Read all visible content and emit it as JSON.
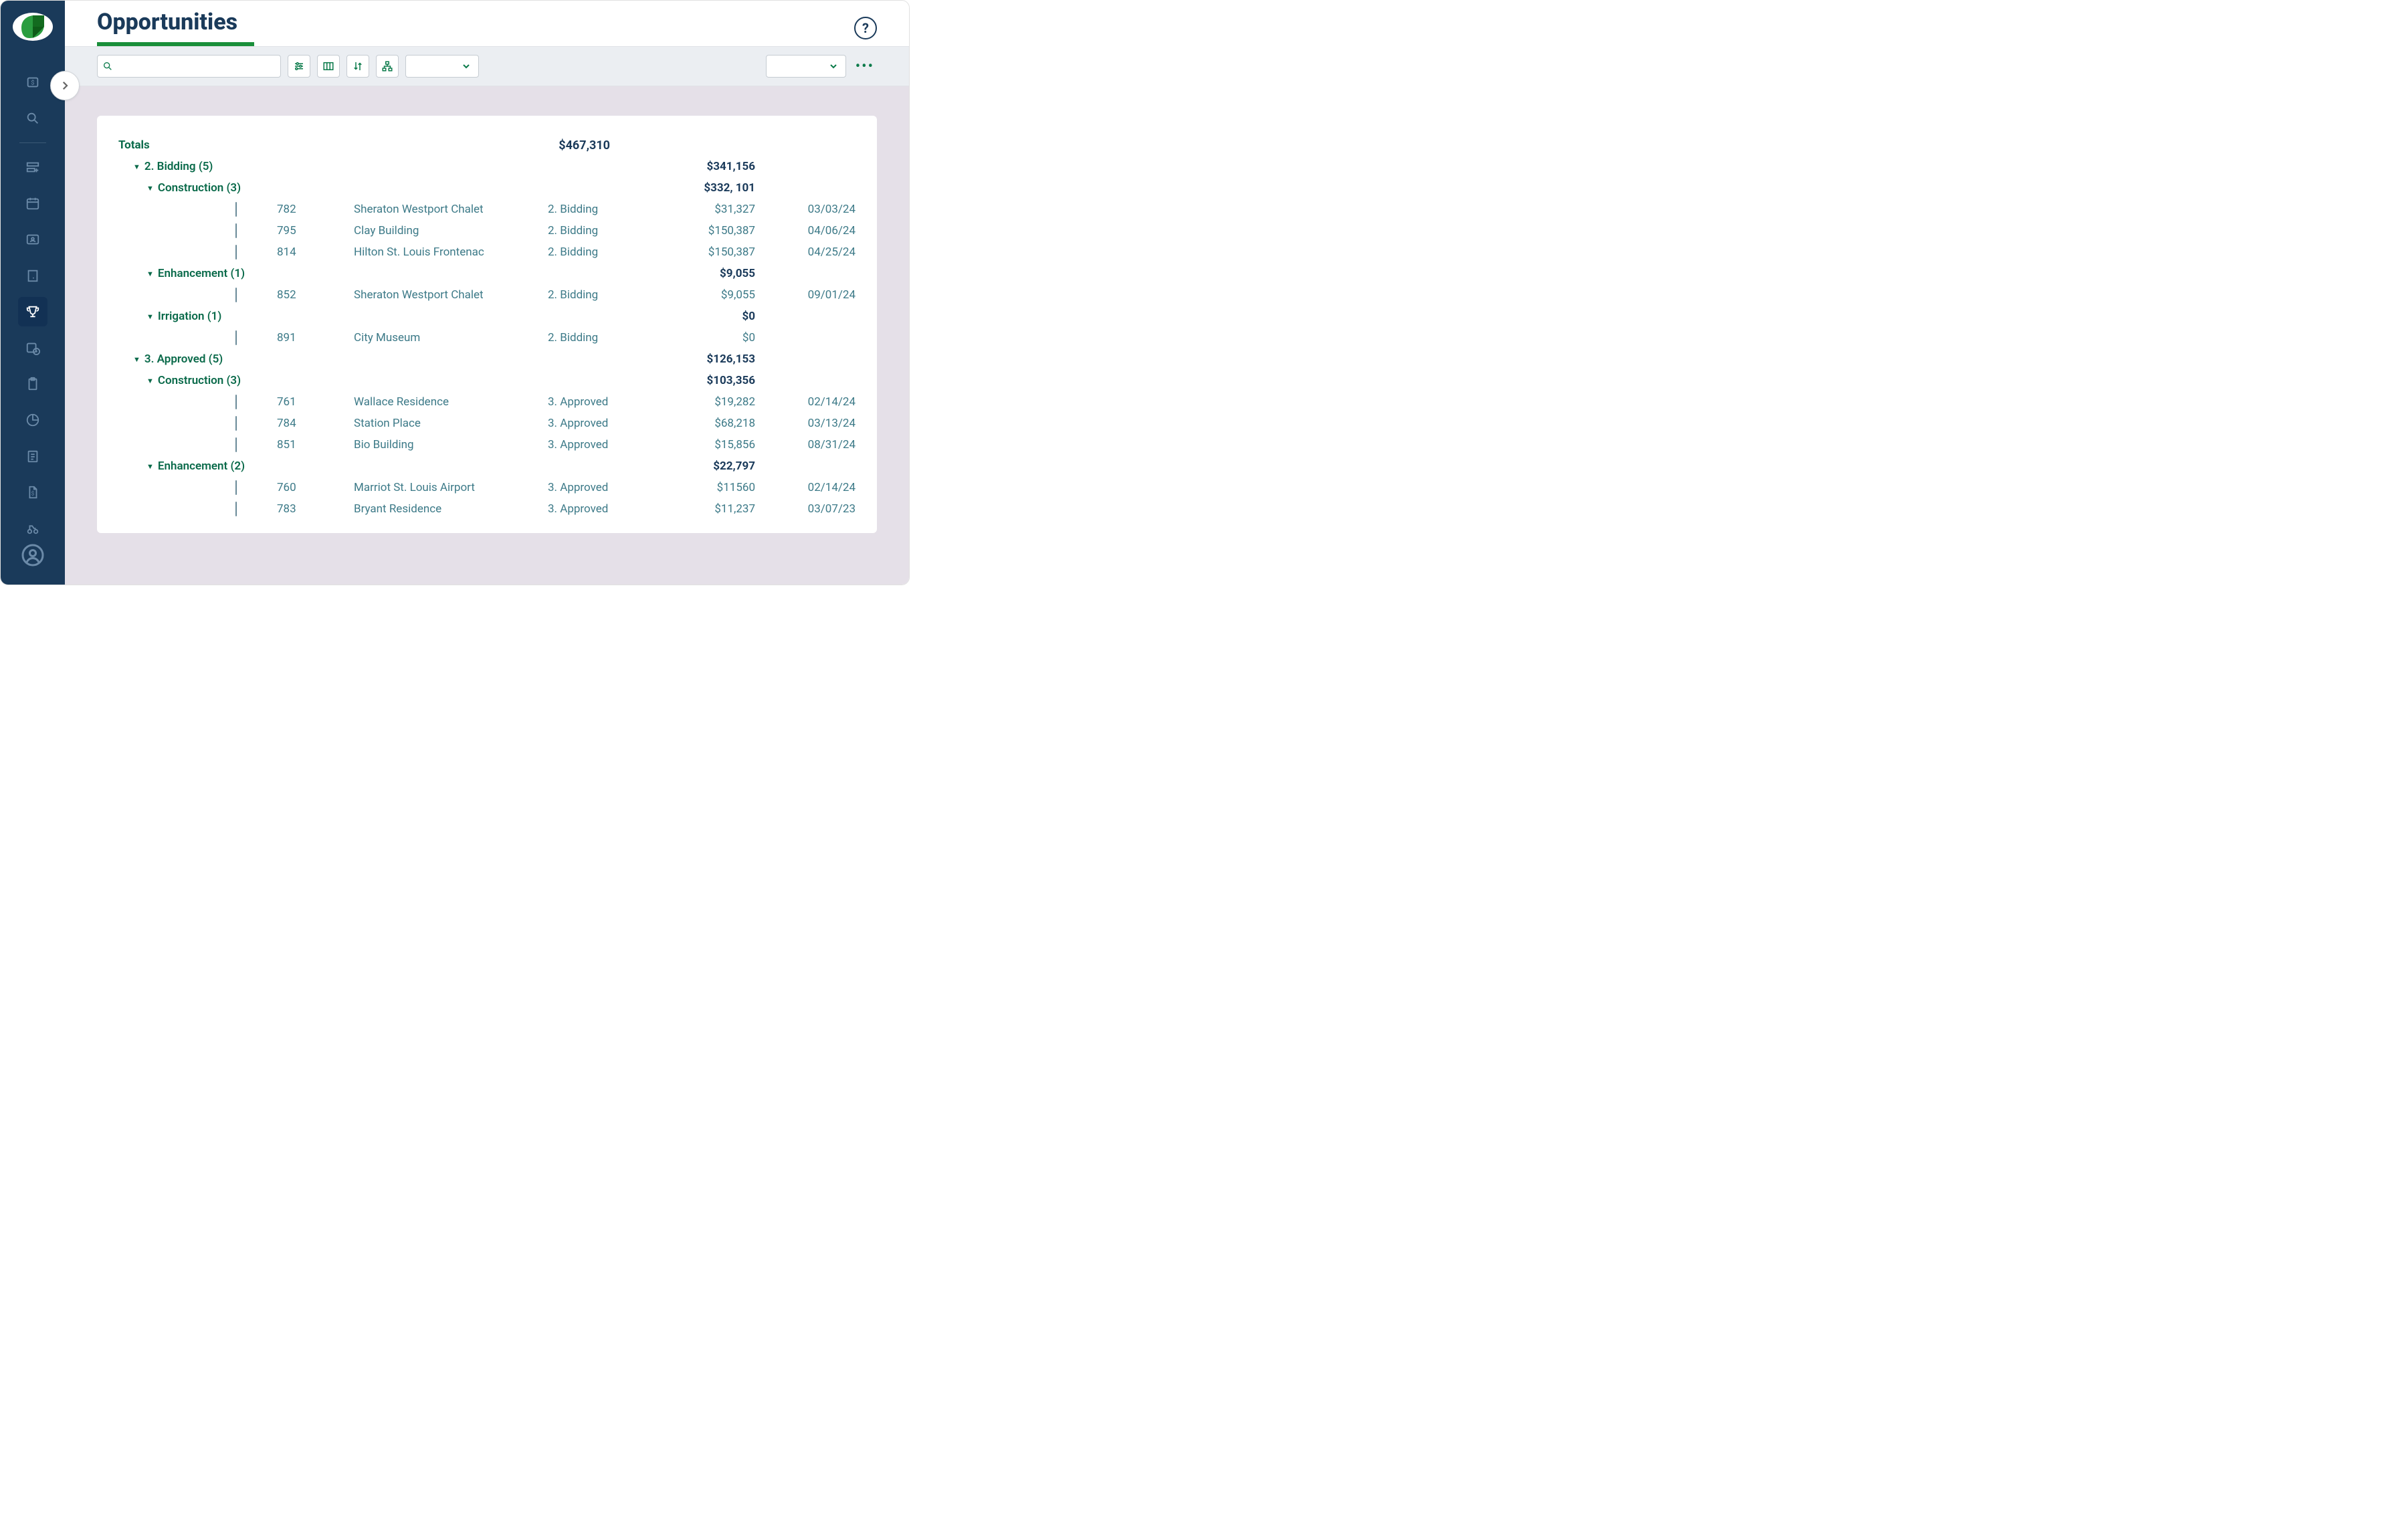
{
  "page": {
    "title": "Opportunities"
  },
  "help": {
    "label": "?"
  },
  "search": {
    "placeholder": ""
  },
  "totals": {
    "label": "Totals",
    "amount": "$467,310"
  },
  "groups": [
    {
      "label": "2. Bidding (5)",
      "amount": "$341,156",
      "subgroups": [
        {
          "label": "Construction (3)",
          "amount": "$332, 101",
          "rows": [
            {
              "id": "782",
              "name": "Sheraton Westport Chalet",
              "stage": "2. Bidding",
              "amount": "$31,327",
              "date": "03/03/24"
            },
            {
              "id": "795",
              "name": "Clay Building",
              "stage": "2. Bidding",
              "amount": "$150,387",
              "date": "04/06/24"
            },
            {
              "id": "814",
              "name": "Hilton St. Louis Frontenac",
              "stage": "2. Bidding",
              "amount": "$150,387",
              "date": "04/25/24"
            }
          ]
        },
        {
          "label": "Enhancement (1)",
          "amount": "$9,055",
          "rows": [
            {
              "id": "852",
              "name": "Sheraton Westport Chalet",
              "stage": "2. Bidding",
              "amount": "$9,055",
              "date": "09/01/24"
            }
          ]
        },
        {
          "label": "Irrigation (1)",
          "amount": "$0",
          "rows": [
            {
              "id": "891",
              "name": "City Museum",
              "stage": "2. Bidding",
              "amount": "$0",
              "date": ""
            }
          ]
        }
      ]
    },
    {
      "label": "3. Approved (5)",
      "amount": "$126,153",
      "subgroups": [
        {
          "label": "Construction (3)",
          "amount": "$103,356",
          "rows": [
            {
              "id": "761",
              "name": "Wallace Residence",
              "stage": "3. Approved",
              "amount": "$19,282",
              "date": "02/14/24"
            },
            {
              "id": "784",
              "name": "Station Place",
              "stage": "3. Approved",
              "amount": "$68,218",
              "date": "03/13/24"
            },
            {
              "id": "851",
              "name": "Bio Building",
              "stage": "3. Approved",
              "amount": "$15,856",
              "date": "08/31/24"
            }
          ]
        },
        {
          "label": "Enhancement (2)",
          "amount": "$22,797",
          "rows": [
            {
              "id": "760",
              "name": "Marriot St. Louis Airport",
              "stage": "3. Approved",
              "amount": "$11560",
              "date": "02/14/24"
            },
            {
              "id": "783",
              "name": "Bryant Residence",
              "stage": "3. Approved",
              "amount": "$11,237",
              "date": "03/07/23"
            }
          ]
        }
      ]
    }
  ]
}
